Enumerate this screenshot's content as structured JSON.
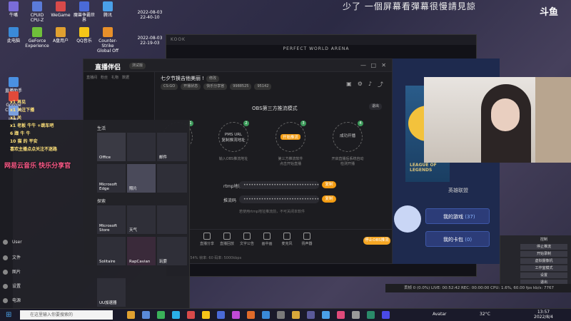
{
  "stream": {
    "caption": "少了 一個屏幕看彈幕很慢請見諒",
    "platform_logo": "斗鱼"
  },
  "desktop_icons": [
    {
      "label": "牛嘴",
      "color": "#7a6cd8"
    },
    {
      "label": "CPUID CPU-Z",
      "color": "#5b7bd8"
    },
    {
      "label": "WeGame",
      "color": "#d84a4a"
    },
    {
      "label": "魔兽争霸世界",
      "color": "#4a6ad8"
    },
    {
      "label": "腾讯",
      "color": "#4aa0e8"
    },
    {
      "label": "此电脑",
      "color": "#3a8ad8"
    },
    {
      "label": "GeForce Experience",
      "color": "#6fbf3a"
    },
    {
      "label": "A盘用户",
      "color": "#e0a030"
    },
    {
      "label": "QQ音乐",
      "color": "#f5c518"
    },
    {
      "label": "Counter-Strike Global Off",
      "color": "#e8902a"
    },
    {
      "label": "直播助手",
      "color": "#4a90e2"
    },
    {
      "label": "Google Chrome",
      "color": "#e04a3a"
    },
    {
      "label": "User",
      "color": "#7aa0e0"
    },
    {
      "label": "Logitech G HUB",
      "color": "#3ab0e8"
    },
    {
      "label": "socialMedia",
      "color": "#555"
    }
  ],
  "desktop_timestamps": [
    "2022-08-03\n22-40-10",
    "2022-08-03\n22-19-03"
  ],
  "game_window": {
    "title": "KOOK",
    "subtitle": "PERFECT WORLD ARENA"
  },
  "app": {
    "title": "直播伴侣",
    "badge": "测试版",
    "room_title": "七夕节换吉他美丽 !",
    "room_tag": "修改",
    "tags": [
      "CS:GO",
      "开播状态",
      "快乐分享官",
      "9988525",
      "95142"
    ],
    "left_tabs": [
      "直播间",
      "粉丝",
      "礼物",
      "数据"
    ],
    "obs_mode_title": "OBS第三方推流模式",
    "exit_btn": "退出",
    "steps": [
      {
        "n": "1",
        "label": "",
        "desc": "添加推流地址"
      },
      {
        "n": "2",
        "label": "PMS URL\n复制推流地址",
        "desc": "输入OBS推流地址"
      },
      {
        "n": "3",
        "label": "开始推流",
        "desc": "第三方推流软件\n点击开始直播"
      },
      {
        "n": "4",
        "label": "成功开播",
        "desc": "开启直播后系统自动\n检测开播"
      }
    ],
    "rtmp_label": "rtmp地址",
    "rtmp_value": "••••••••••••••••••••••••••••••",
    "rtmp_btn": "复制",
    "key_label": "推流码",
    "key_value": "••••••••••••••••••••••••••••••",
    "key_btn": "复制",
    "note": "若使用rtmp地址推流前，不可关闭本软件",
    "toolbar": [
      {
        "name": "toolbar-share",
        "label": "直播分享"
      },
      {
        "name": "toolbar-record",
        "label": "直播回放"
      },
      {
        "name": "toolbar-text",
        "label": "文字公告"
      },
      {
        "name": "toolbar-window",
        "label": "画中画"
      },
      {
        "name": "toolbar-mic",
        "label": "麦克风"
      },
      {
        "name": "toolbar-speaker",
        "label": "扬声器"
      }
    ],
    "start_btn": "停止OBS推流",
    "status_strip": "CPU: 15%   内存: 54%   帧率: 60   码率: 5000kbps"
  },
  "start_menu": {
    "section1": "生活",
    "section2": "探索",
    "tiles": [
      {
        "label": "Office",
        "color": "#3a3a44"
      },
      {
        "label": "",
        "color": "#2f2f38"
      },
      {
        "label": "邮件",
        "color": "#2f2f38"
      },
      {
        "label": "Microsoft Edge",
        "color": "#2f2f38"
      },
      {
        "label": "照片",
        "color": "#4a4a5a"
      },
      {
        "label": "",
        "color": "#2f2f38"
      },
      {
        "label": "Microsoft Store",
        "color": "#2f2f38"
      },
      {
        "label": "天气",
        "color": "#2f2f38"
      },
      {
        "label": "",
        "color": "#2f2f38"
      },
      {
        "label": "Solitaire",
        "color": "#2f2f38"
      },
      {
        "label": "RapCavian",
        "color": "#3a2a3a"
      },
      {
        "label": "玩耍",
        "color": "#2f2f38"
      },
      {
        "label": "UU加速器",
        "color": "#2f2f38"
      }
    ],
    "side": [
      "User",
      "文件",
      "图片",
      "设置",
      "电源"
    ]
  },
  "chat_lines": [
    "x1 再见",
    "x1 关注下播",
    "x1 关",
    "x1 老板 牛牛 +跳车吧",
    "6 蹭 牛 牛",
    "10 猫 的 平安",
    "喜欢主播点点关注不迷路"
  ],
  "music_banner": "网易云音乐 快乐分享官",
  "mobile": {
    "lol_text": "LEAGUE OF LEGENDS",
    "hero_label": "英雄联盟",
    "my_games": "我的游戏",
    "my_games_count": "(37)",
    "my_cards": "我的卡包",
    "my_cards_count": "(0)"
  },
  "obs_controls": [
    "控制",
    "停止推流",
    "开始录制",
    "虚拟摄像机",
    "工作室模式",
    "设置",
    "退出"
  ],
  "obs_status": "丢帧 0 (0.0%)   LIVE: 00:52:42   REC: 00:00:00   CPU: 1.6%, 60.00 fps   kb/s: 7767",
  "taskbar": {
    "search_placeholder": "在这里输入你要搜索的",
    "avatar_label": "Avatar",
    "weather": "32°C",
    "time": "13:57",
    "date": "2022/8/4"
  }
}
